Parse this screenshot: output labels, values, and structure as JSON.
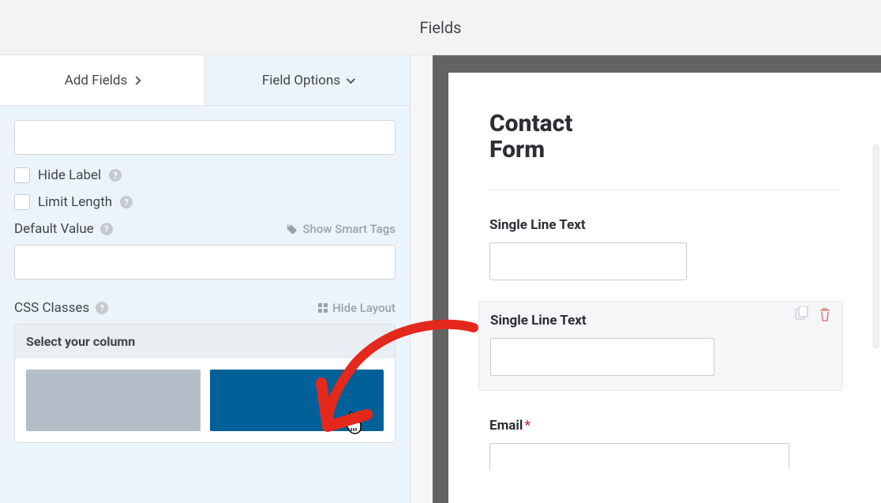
{
  "topbar": {
    "title": "Fields"
  },
  "tabs": {
    "add_fields_label": "Add Fields",
    "field_options_label": "Field Options"
  },
  "options": {
    "hide_label": "Hide Label",
    "limit_length": "Limit Length",
    "default_value_label": "Default Value",
    "show_smart_tags_label": "Show Smart Tags",
    "css_classes_label": "CSS Classes",
    "hide_layout_label": "Hide Layout",
    "column_selector_title": "Select your column"
  },
  "preview": {
    "form_title": "Contact Form",
    "fields": [
      {
        "label": "Single Line Text",
        "required": false,
        "selected": false
      },
      {
        "label": "Single Line Text",
        "required": false,
        "selected": true
      },
      {
        "label": "Email",
        "required": true,
        "selected": false
      }
    ]
  }
}
